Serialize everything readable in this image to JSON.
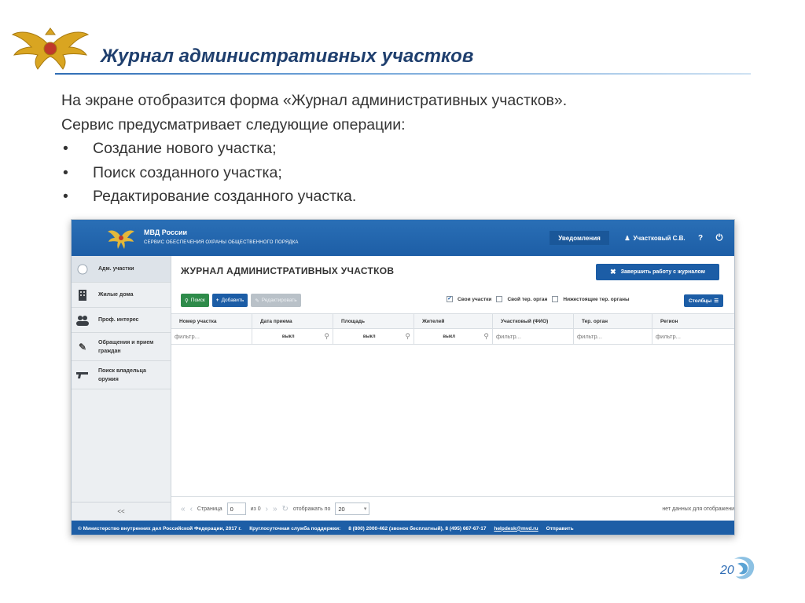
{
  "slide": {
    "title": "Журнал административных участков",
    "intro_line1": "На экране отобразится форма «Журнал административных участков».",
    "intro_line2": "Сервис предусматривает следующие операции:",
    "bullet_char": "•",
    "bullets": [
      "Создание нового участка;",
      "Поиск созданного участка;",
      "Редактирование созданного участка."
    ],
    "page_number": "20"
  },
  "app": {
    "brand": "МВД России",
    "subtitle": "Сервис обеспечения охраны общественного порядка",
    "notifications": "Уведомления",
    "user": "Участковый С.В.",
    "help": "?",
    "sidebar": [
      {
        "label": "Адм. участки",
        "icon": "circle-icon"
      },
      {
        "label": "Жилые дома",
        "icon": "building-icon"
      },
      {
        "label": "Проф. интерес",
        "icon": "people-icon"
      },
      {
        "label": "Обращения и прием граждан",
        "icon": "edit-icon"
      },
      {
        "label": "Поиск владельца оружия",
        "icon": "gun-icon"
      }
    ],
    "collapse": "<<",
    "page_heading": "ЖУРНАЛ АДМИНИСТРАТИВНЫХ УЧАСТКОВ",
    "finish_button": "Завершить работу с журналом",
    "toolbar": {
      "search": "Поиск",
      "add": "Добавить",
      "edit": "Редактировать"
    },
    "filters": {
      "own": "Свои участки",
      "own_checked": true,
      "own_org": "Свой тер. орган",
      "lower_org": "Нижестоящие тер. органы"
    },
    "columns_button": "Столбцы",
    "grid_headers": [
      "Номер участка",
      "Дата приема",
      "Площадь",
      "Жителей",
      "Участковый (ФИО)",
      "Тер. орган",
      "Регион"
    ],
    "grid_filters": [
      "фильтр...",
      "выкл",
      "выкл",
      "выкл",
      "фильтр...",
      "фильтр...",
      "фильтр..."
    ],
    "pager": {
      "page_label": "Страница",
      "page_value": "0",
      "of_label": "из 0",
      "per_page_label": "отображать по",
      "per_page_value": "20",
      "no_data": "нет данных для отображени"
    },
    "footer": {
      "copyright": "© Министерство внутренних дел Российской Федерации, 2017 г.",
      "support_label": "Круглосуточная служба поддержки:",
      "phones": "8 (800) 2000-462 (звонок бесплатный), 8 (495) 667-67-17",
      "email": "helpdesk@mvd.ru",
      "send": "Отправить"
    }
  },
  "colors": {
    "brand_blue": "#1d5ea6",
    "search_green": "#2e8b4a",
    "title_blue": "#1f3f6e"
  }
}
